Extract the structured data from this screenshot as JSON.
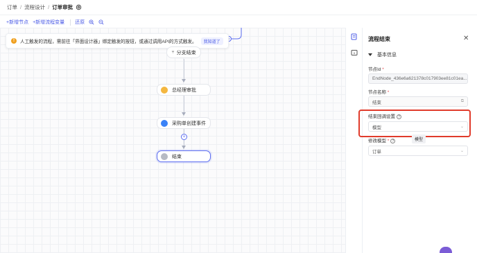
{
  "breadcrumb": {
    "items": [
      "订单",
      "流程设计"
    ],
    "current": "订单审批",
    "separator": "/"
  },
  "toolbar": {
    "add_node": "+新增节点",
    "add_var": "+新增流程变量",
    "restore": "还原"
  },
  "notice": {
    "text": "人工触发的流程，需前往「界面设计器」绑定触发的按钮，或通过调用API的方式触发。",
    "dismiss": "我知道了"
  },
  "flow": {
    "branch_end": "分支结束",
    "nodes": [
      {
        "label": "总经理审批",
        "color": "#f4b740"
      },
      {
        "label": "采购单创建事件",
        "color": "#3a82f7"
      },
      {
        "label": "结束",
        "color": "#b6bac4"
      }
    ]
  },
  "panel": {
    "title": "流程结束",
    "section": "基本信息",
    "node_id_label": "节点Id",
    "node_id_value": "EndNode_436e6a621378c017903ee81c01ea...",
    "node_name_label": "节点名称",
    "node_name_value": "结束",
    "return_label": "结束回调设置",
    "return_value": "模型",
    "modify_label": "修改模型",
    "modify_value": "订单",
    "tooltip": "模型"
  },
  "colors": {
    "accent": "#4b5be6",
    "highlight": "#e03b2b"
  }
}
